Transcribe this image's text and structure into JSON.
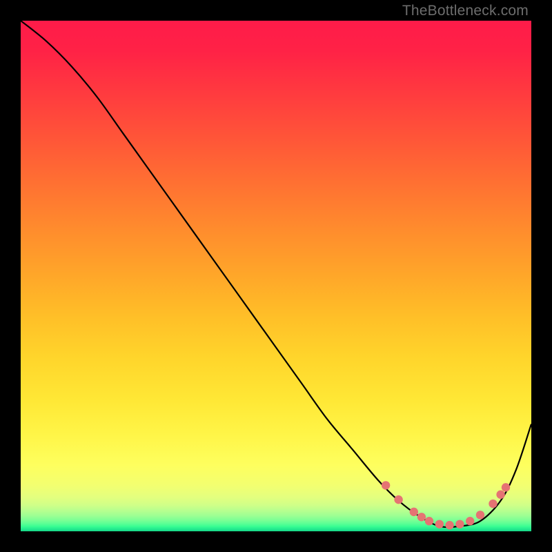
{
  "watermark": "TheBottleneck.com",
  "chart_data": {
    "type": "line",
    "title": "",
    "xlabel": "",
    "ylabel": "",
    "xlim": [
      0,
      100
    ],
    "ylim": [
      0,
      100
    ],
    "x": [
      0,
      5,
      10,
      15,
      20,
      25,
      30,
      35,
      40,
      45,
      50,
      55,
      60,
      65,
      70,
      74,
      78,
      82,
      86,
      90,
      94,
      97,
      100
    ],
    "values": [
      100,
      96,
      91,
      85,
      78,
      71,
      64,
      57,
      50,
      43,
      36,
      29,
      22,
      16,
      10,
      6,
      3,
      1,
      1,
      2,
      6,
      12,
      21
    ],
    "marker_points": [
      {
        "x": 71.5,
        "y": 9.0
      },
      {
        "x": 74.0,
        "y": 6.2
      },
      {
        "x": 77.0,
        "y": 3.8
      },
      {
        "x": 78.5,
        "y": 2.8
      },
      {
        "x": 80.0,
        "y": 2.0
      },
      {
        "x": 82.0,
        "y": 1.4
      },
      {
        "x": 84.0,
        "y": 1.2
      },
      {
        "x": 86.0,
        "y": 1.4
      },
      {
        "x": 88.0,
        "y": 2.0
      },
      {
        "x": 90.0,
        "y": 3.2
      },
      {
        "x": 92.5,
        "y": 5.4
      },
      {
        "x": 94.0,
        "y": 7.2
      },
      {
        "x": 95.0,
        "y": 8.6
      }
    ],
    "gradient": {
      "stops": [
        {
          "pos": 0.0,
          "color": "#ff1b49"
        },
        {
          "pos": 0.06,
          "color": "#ff2246"
        },
        {
          "pos": 0.14,
          "color": "#ff3a3f"
        },
        {
          "pos": 0.23,
          "color": "#ff5538"
        },
        {
          "pos": 0.32,
          "color": "#ff7132"
        },
        {
          "pos": 0.41,
          "color": "#ff8c2d"
        },
        {
          "pos": 0.5,
          "color": "#ffa729"
        },
        {
          "pos": 0.58,
          "color": "#ffbf28"
        },
        {
          "pos": 0.66,
          "color": "#ffd52b"
        },
        {
          "pos": 0.74,
          "color": "#ffe735"
        },
        {
          "pos": 0.81,
          "color": "#fff547"
        },
        {
          "pos": 0.87,
          "color": "#feff5e"
        },
        {
          "pos": 0.91,
          "color": "#f3ff70"
        },
        {
          "pos": 0.932,
          "color": "#e4ff7e"
        },
        {
          "pos": 0.948,
          "color": "#d0ff88"
        },
        {
          "pos": 0.96,
          "color": "#b7ff8f"
        },
        {
          "pos": 0.97,
          "color": "#9aff93"
        },
        {
          "pos": 0.978,
          "color": "#7bff95"
        },
        {
          "pos": 0.985,
          "color": "#5aff95"
        },
        {
          "pos": 0.991,
          "color": "#39fd93"
        },
        {
          "pos": 0.996,
          "color": "#22e98e"
        },
        {
          "pos": 1.0,
          "color": "#16d487"
        }
      ]
    }
  }
}
